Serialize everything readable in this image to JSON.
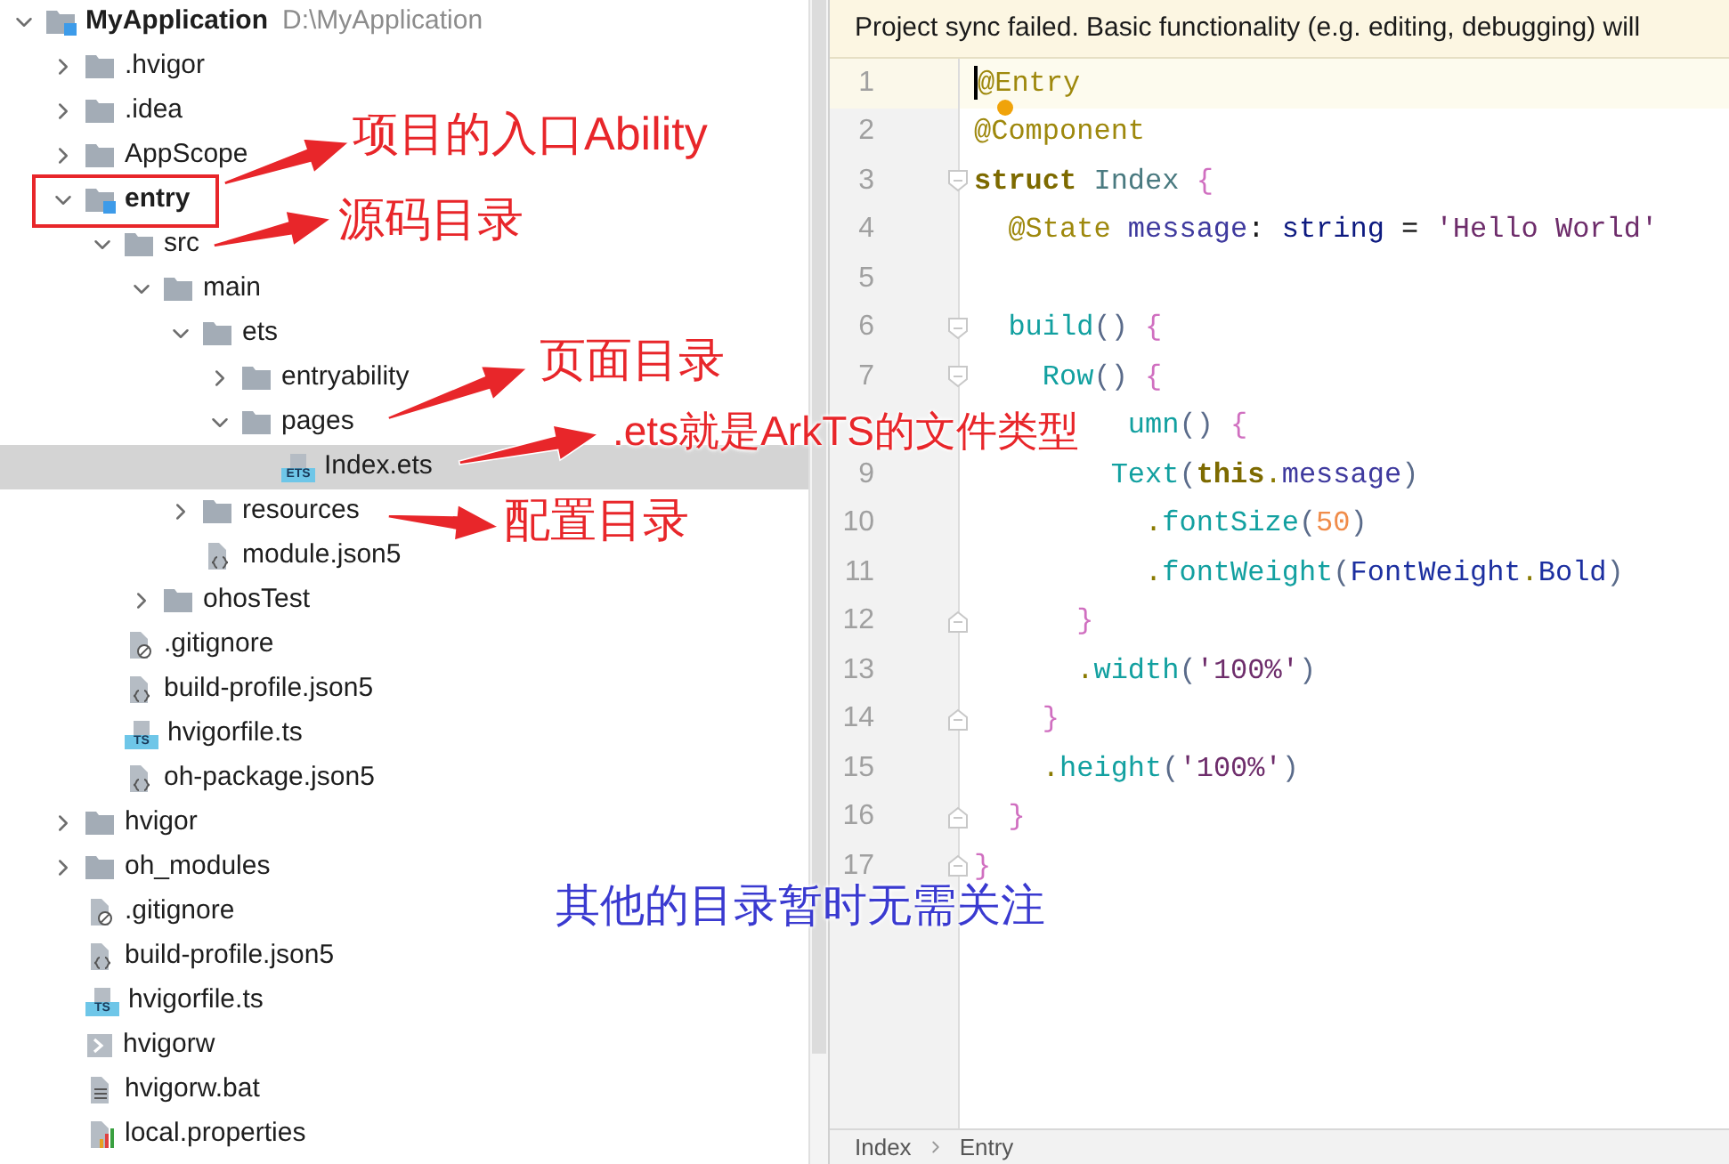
{
  "tree": [
    {
      "label": "MyApplication",
      "kind": "project",
      "path": "D:\\MyApplication",
      "expanded": true,
      "selected": false,
      "children": [
        {
          "label": ".hvigor",
          "kind": "folder",
          "expanded": false,
          "selected": false
        },
        {
          "label": ".idea",
          "kind": "folder",
          "expanded": false,
          "selected": false
        },
        {
          "label": "AppScope",
          "kind": "folder",
          "expanded": false,
          "selected": false
        },
        {
          "label": "entry",
          "kind": "module",
          "expanded": true,
          "selected": false,
          "boxed": true,
          "children": [
            {
              "label": "src",
              "kind": "folder",
              "expanded": true,
              "selected": false,
              "children": [
                {
                  "label": "main",
                  "kind": "folder",
                  "expanded": true,
                  "selected": false,
                  "children": [
                    {
                      "label": "ets",
                      "kind": "folder",
                      "expanded": true,
                      "selected": false,
                      "children": [
                        {
                          "label": "entryability",
                          "kind": "folder",
                          "expanded": false,
                          "selected": false
                        },
                        {
                          "label": "pages",
                          "kind": "folder",
                          "expanded": true,
                          "selected": false,
                          "children": [
                            {
                              "label": "Index.ets",
                              "kind": "ets",
                              "icon_text": "ETS",
                              "selected": true
                            }
                          ]
                        }
                      ]
                    },
                    {
                      "label": "resources",
                      "kind": "folder",
                      "expanded": false,
                      "selected": false
                    },
                    {
                      "label": "module.json5",
                      "kind": "json",
                      "selected": false
                    }
                  ]
                },
                {
                  "label": "ohosTest",
                  "kind": "folder",
                  "expanded": false,
                  "selected": false
                }
              ]
            },
            {
              "label": ".gitignore",
              "kind": "ignore",
              "selected": false
            },
            {
              "label": "build-profile.json5",
              "kind": "json",
              "selected": false
            },
            {
              "label": "hvigorfile.ts",
              "kind": "ts",
              "icon_text": "TS",
              "selected": false
            },
            {
              "label": "oh-package.json5",
              "kind": "json",
              "selected": false
            }
          ]
        },
        {
          "label": "hvigor",
          "kind": "folder",
          "expanded": false,
          "selected": false
        },
        {
          "label": "oh_modules",
          "kind": "folder",
          "expanded": false,
          "selected": false
        },
        {
          "label": ".gitignore",
          "kind": "ignore",
          "selected": false
        },
        {
          "label": "build-profile.json5",
          "kind": "json",
          "selected": false
        },
        {
          "label": "hvigorfile.ts",
          "kind": "ts",
          "icon_text": "TS",
          "selected": false
        },
        {
          "label": "hvigorw",
          "kind": "shell",
          "selected": false
        },
        {
          "label": "hvigorw.bat",
          "kind": "bat",
          "selected": false
        },
        {
          "label": "local.properties",
          "kind": "properties",
          "selected": false
        }
      ]
    }
  ],
  "banner": {
    "text": "Project sync failed. Basic functionality (e.g. editing, debugging) will"
  },
  "code_lines": [
    {
      "number": "1",
      "current": true,
      "tokens": [
        {
          "t": "@Entry",
          "kind": "decorator"
        }
      ]
    },
    {
      "number": "2",
      "bulb": true,
      "tokens": [
        {
          "t": "@Component",
          "kind": "decorator"
        }
      ]
    },
    {
      "number": "3",
      "fold_open": true,
      "tokens": [
        {
          "t": "struct ",
          "kind": "keyword"
        },
        {
          "t": "Index ",
          "kind": "type"
        },
        {
          "t": "{",
          "kind": "brace"
        }
      ]
    },
    {
      "number": "4",
      "tokens": [
        {
          "t": "  @State ",
          "kind": "decorator"
        },
        {
          "t": "message",
          "kind": "field"
        },
        {
          "t": ": ",
          "kind": "plain"
        },
        {
          "t": "string",
          "kind": "typekw"
        },
        {
          "t": " = ",
          "kind": "plain"
        },
        {
          "t": "'Hello World'",
          "kind": "string"
        }
      ]
    },
    {
      "number": "5"
    },
    {
      "number": "6",
      "fold_open": true,
      "tokens": [
        {
          "t": "  build",
          "kind": "call"
        },
        {
          "t": "() ",
          "kind": "paren"
        },
        {
          "t": "{",
          "kind": "brace"
        }
      ]
    },
    {
      "number": "7",
      "fold_open": true,
      "tokens": [
        {
          "t": "    Row",
          "kind": "call"
        },
        {
          "t": "() ",
          "kind": "paren"
        },
        {
          "t": "{",
          "kind": "brace"
        }
      ]
    },
    {
      "tokens": [
        {
          "t": "         umn",
          "kind": "call"
        },
        {
          "t": "() ",
          "kind": "paren"
        },
        {
          "t": "{",
          "kind": "brace"
        }
      ]
    },
    {
      "number": "9",
      "tokens": [
        {
          "t": "        Text",
          "kind": "call"
        },
        {
          "t": "(",
          "kind": "paren"
        },
        {
          "t": "this",
          "kind": "keyword"
        },
        {
          "t": ".",
          "kind": "punct"
        },
        {
          "t": "message",
          "kind": "field"
        },
        {
          "t": ")",
          "kind": "paren"
        }
      ]
    },
    {
      "number": "10",
      "tokens": [
        {
          "t": "          .",
          "kind": "punct"
        },
        {
          "t": "fontSize",
          "kind": "call"
        },
        {
          "t": "(",
          "kind": "paren"
        },
        {
          "t": "50",
          "kind": "number"
        },
        {
          "t": ")",
          "kind": "paren"
        }
      ]
    },
    {
      "number": "11",
      "tokens": [
        {
          "t": "          .",
          "kind": "punct"
        },
        {
          "t": "fontWeight",
          "kind": "call"
        },
        {
          "t": "(",
          "kind": "paren"
        },
        {
          "t": "FontWeight",
          "kind": "enum"
        },
        {
          "t": ".",
          "kind": "punct"
        },
        {
          "t": "Bold",
          "kind": "enum"
        },
        {
          "t": ")",
          "kind": "paren"
        }
      ]
    },
    {
      "number": "12",
      "fold_close": true,
      "tokens": [
        {
          "t": "      }",
          "kind": "brace"
        }
      ]
    },
    {
      "number": "13",
      "tokens": [
        {
          "t": "      .",
          "kind": "punct"
        },
        {
          "t": "width",
          "kind": "call"
        },
        {
          "t": "(",
          "kind": "paren"
        },
        {
          "t": "'100%'",
          "kind": "string"
        },
        {
          "t": ")",
          "kind": "paren"
        }
      ]
    },
    {
      "number": "14",
      "fold_close": true,
      "tokens": [
        {
          "t": "    }",
          "kind": "brace"
        }
      ]
    },
    {
      "number": "15",
      "tokens": [
        {
          "t": "    .",
          "kind": "punct"
        },
        {
          "t": "height",
          "kind": "call"
        },
        {
          "t": "(",
          "kind": "paren"
        },
        {
          "t": "'100%'",
          "kind": "string"
        },
        {
          "t": ")",
          "kind": "paren"
        }
      ]
    },
    {
      "number": "16",
      "fold_close": true,
      "tokens": [
        {
          "t": "  }",
          "kind": "brace"
        }
      ]
    },
    {
      "number": "17",
      "fold_close": true,
      "tokens": [
        {
          "t": "}",
          "kind": "brace"
        }
      ]
    }
  ],
  "breadcrumb": [
    "Index",
    "Entry"
  ],
  "annotations": [
    {
      "text": "项目的入口Ability",
      "color": "#e8262a"
    },
    {
      "text": "源码目录",
      "color": "#e8262a"
    },
    {
      "text": "页面目录",
      "color": "#e8262a"
    },
    {
      "text": ".ets就是ArkTS的文件类型",
      "color": "#e8262a"
    },
    {
      "text": "配置目录",
      "color": "#e8262a"
    },
    {
      "text": "其他的目录暂时无需关注",
      "color": "#3a3ad0"
    }
  ]
}
